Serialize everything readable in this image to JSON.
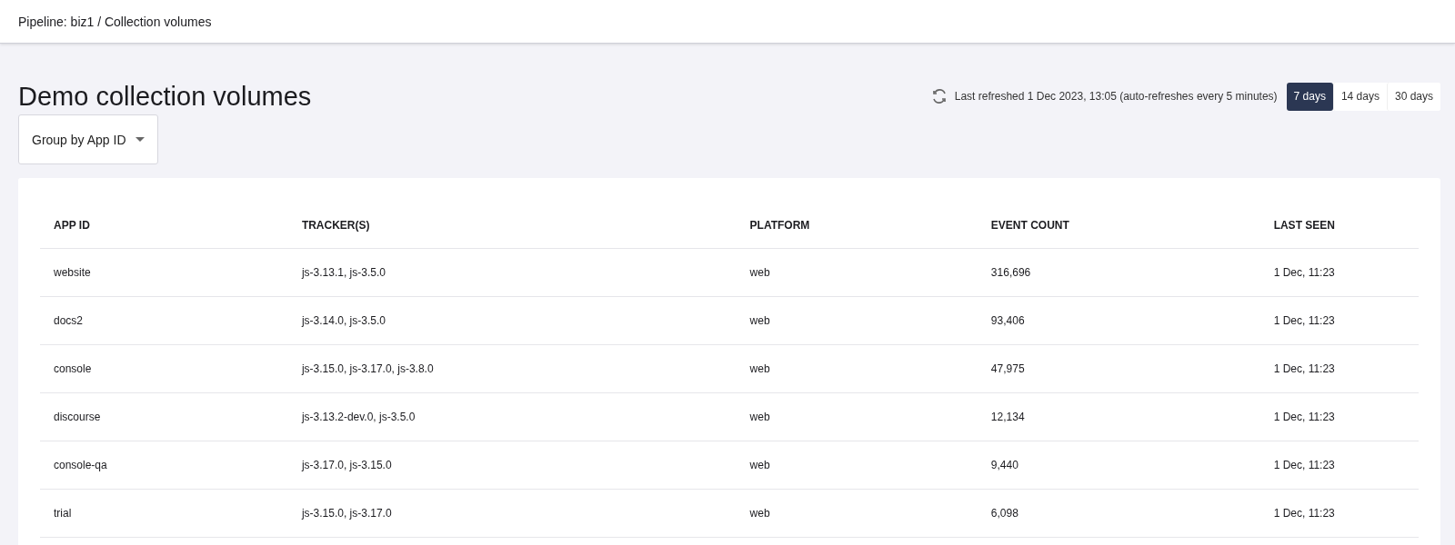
{
  "breadcrumb": "Pipeline: biz1 / Collection volumes",
  "page_title": "Demo collection volumes",
  "refresh_status": "Last refreshed 1 Dec 2023, 13:05 (auto-refreshes every 5 minutes)",
  "range_tabs": [
    {
      "label": "7 days",
      "selected": true
    },
    {
      "label": "14 days",
      "selected": false
    },
    {
      "label": "30 days",
      "selected": false
    }
  ],
  "group_by": {
    "label": "Group by App ID"
  },
  "table": {
    "columns": [
      "APP ID",
      "TRACKER(S)",
      "PLATFORM",
      "EVENT COUNT",
      "LAST SEEN"
    ],
    "rows": [
      [
        "website",
        "js-3.13.1, js-3.5.0",
        "web",
        "316,696",
        "1 Dec, 11:23"
      ],
      [
        "docs2",
        "js-3.14.0, js-3.5.0",
        "web",
        "93,406",
        "1 Dec, 11:23"
      ],
      [
        "console",
        "js-3.15.0, js-3.17.0, js-3.8.0",
        "web",
        "47,975",
        "1 Dec, 11:23"
      ],
      [
        "discourse",
        "js-3.13.2-dev.0, js-3.5.0",
        "web",
        "12,134",
        "1 Dec, 11:23"
      ],
      [
        "console-qa",
        "js-3.17.0, js-3.15.0",
        "web",
        "9,440",
        "1 Dec, 11:23"
      ],
      [
        "trial",
        "js-3.15.0, js-3.17.0",
        "web",
        "6,098",
        "1 Dec, 11:23"
      ]
    ]
  }
}
